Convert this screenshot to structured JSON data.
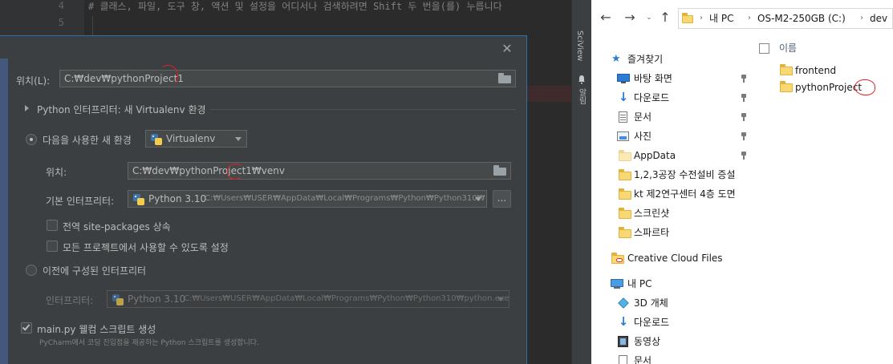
{
  "ide": {
    "line_numbers": [
      "4",
      "5"
    ],
    "code_comment": "# 클래스, 파일, 도구 창, 액션 및 설정을 어디서나 검색하려면 Shift 두 번을(를) 누릅니다",
    "sidebar": {
      "sciview": "SciView",
      "notifications": "알림"
    }
  },
  "dialog": {
    "location_label": "위치(L):",
    "location_value": "C:₩dev₩pythonProject1",
    "interpreter_section_title": "Python 인터프리터: 새 Virtualenv 환경",
    "new_env_radio_label": "다음을 사용한 새 환경",
    "env_tool_value": "Virtualenv",
    "venv_location_label": "위치:",
    "venv_location_value": "C:₩dev₩pythonProject1₩venv",
    "base_interpreter_label": "기본 인터프리터:",
    "base_interpreter_version": "Python 3.10",
    "base_interpreter_path": "C:₩Users₩USER₩AppData₩Local₩Programs₩Python₩Python310₩",
    "browse_button": "...",
    "inherit_site_packages_label": "전역 site-packages 상속",
    "make_available_label": "모든 프로젝트에서 사용할 수 있도록 설정",
    "existing_interpreter_radio_label": "이전에 구성된 인터프리터",
    "interpreter_label": "인터프리터:",
    "existing_interpreter_version": "Python 3.10",
    "existing_interpreter_path": "C:₩Users₩USER₩AppData₩Local₩Programs₩Python₩Python310₩python.exe",
    "welcome_script_label": "main.py 웰컴 스크립트 생성",
    "welcome_script_hint": "PyCharm에서 코딩 진입점을 제공하는 Python 스크립트를 생성합니다.",
    "close_icon": "close-icon"
  },
  "explorer": {
    "breadcrumbs": [
      "내 PC",
      "OS-M2-250GB (C:)",
      "dev"
    ],
    "column_header": "이름",
    "quick_access_title": "즐겨찾기",
    "nav_items": [
      {
        "label": "바탕 화면",
        "icon": "desktop-icon",
        "pinned": true
      },
      {
        "label": "다운로드",
        "icon": "download-icon",
        "pinned": true
      },
      {
        "label": "문서",
        "icon": "document-icon",
        "pinned": true
      },
      {
        "label": "사진",
        "icon": "picture-icon",
        "pinned": true
      },
      {
        "label": "AppData",
        "icon": "folder-icon",
        "pinned": true
      },
      {
        "label": "1,2,3공장 수전설비 증설",
        "icon": "folder-icon",
        "pinned": false
      },
      {
        "label": "kt 제2연구센터 4층 도면",
        "icon": "folder-icon",
        "pinned": false
      },
      {
        "label": "스크린샷",
        "icon": "folder-icon",
        "pinned": false
      },
      {
        "label": "스파르타",
        "icon": "folder-icon",
        "pinned": false
      }
    ],
    "creative_cloud": "Creative Cloud Files",
    "this_pc": "내 PC",
    "pc_items": [
      {
        "label": "3D 개체",
        "icon": "3d-objects-icon"
      },
      {
        "label": "다운로드",
        "icon": "download-icon"
      },
      {
        "label": "동영상",
        "icon": "video-icon"
      },
      {
        "label": "문서",
        "icon": "document-icon"
      }
    ],
    "files": [
      "frontend",
      "pythonProject"
    ]
  },
  "colors": {
    "ide_bg": "#2b2b2b",
    "dialog_bg": "#3c3f41",
    "dialog_border": "#2f6fa7",
    "annotation_red": "#e0202a",
    "folder_yellow": "#f8d775"
  }
}
